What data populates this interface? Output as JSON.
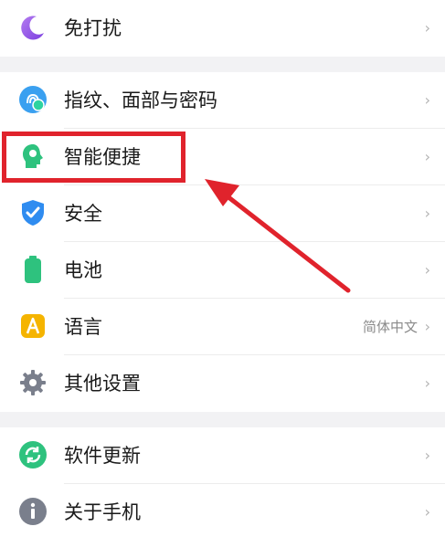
{
  "colors": {
    "background": "#ffffff",
    "section_gap": "#f2f2f4",
    "label_text": "#1a1a1a",
    "chevron": "#b3b3b3",
    "value_text": "#8a8a8a",
    "annotation_red": "#e0232c"
  },
  "settings": {
    "group1": [
      {
        "label": "免打扰",
        "icon": "moon-icon",
        "chevron": "›"
      }
    ],
    "group2": [
      {
        "label": "指纹、面部与密码",
        "icon": "fingerprint-face-icon",
        "chevron": "›"
      },
      {
        "label": "智能便捷",
        "icon": "smart-head-icon",
        "chevron": "›"
      },
      {
        "label": "安全",
        "icon": "shield-check-icon",
        "chevron": "›"
      },
      {
        "label": "电池",
        "icon": "battery-icon",
        "chevron": "›"
      },
      {
        "label": "语言",
        "icon": "language-a-icon",
        "value": "简体中文",
        "chevron": "›"
      },
      {
        "label": "其他设置",
        "icon": "gear-icon",
        "chevron": "›"
      }
    ],
    "group3": [
      {
        "label": "软件更新",
        "icon": "update-sync-icon",
        "chevron": "›"
      },
      {
        "label": "关于手机",
        "icon": "info-icon",
        "chevron": "›"
      }
    ]
  },
  "annotation": {
    "highlighted_item": "智能便捷",
    "shapes": [
      "red-rectangle",
      "red-arrow"
    ]
  }
}
